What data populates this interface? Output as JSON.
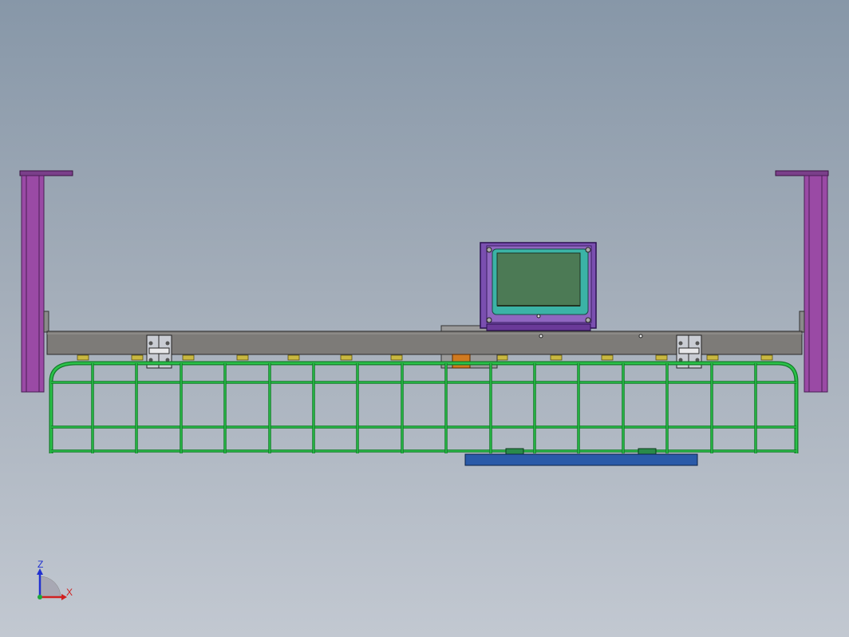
{
  "app": {
    "kind": "cad-viewport",
    "view": "front"
  },
  "colors": {
    "background_top": "#8797a8",
    "background_bottom": "#c2c8d1",
    "post": "#9a4aa5",
    "post_edge": "#4a1e55",
    "beam": "#7d7b78",
    "guard": "#1fa83a",
    "enclosure_body": "#7a4fb0",
    "enclosure_screen": "#4c7a55",
    "enclosure_frame": "#3bb3a6",
    "base_plate": "#2a5aa8",
    "clamp": "#c9ccd3",
    "axis_z": "#2030d0",
    "axis_x": "#d02020"
  },
  "axis_triad": {
    "z_label": "Z",
    "x_label": "X"
  },
  "model": {
    "left_post_name": "left-post",
    "right_post_name": "right-post",
    "beam_name": "crossbeam",
    "guard_name": "wire-guard",
    "enclosure_name": "control-enclosure",
    "base_plate_name": "base-plate"
  }
}
